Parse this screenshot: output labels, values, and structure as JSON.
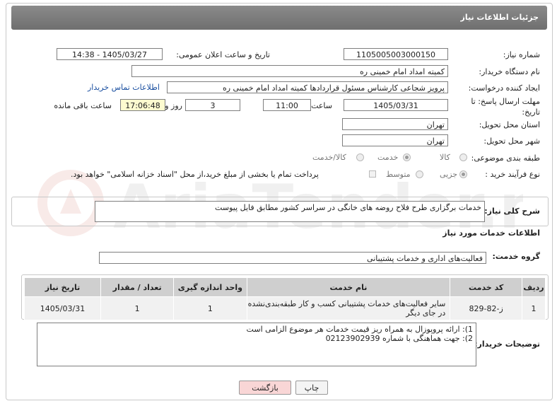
{
  "header": {
    "title": "جزئیات اطلاعات نیاز"
  },
  "form": {
    "need_number_label": "شماره نیاز:",
    "need_number": "1105005003000150",
    "announce_label": "تاریخ و ساعت اعلان عمومی:",
    "announce_value": "1405/03/27 - 14:38",
    "buyer_org_label": "نام دستگاه خریدار:",
    "buyer_org": "کمیته امداد امام خمینی ره",
    "creator_label": "ایجاد کننده درخواست:",
    "creator": "پرویز شجاعی کارشناس مسئول قراردادها کمیته امداد امام خمینی ره",
    "contact_link": "اطلاعات تماس خریدار",
    "deadline_label": "مهلت ارسال پاسخ: تا تاریخ:",
    "deadline_date": "1405/03/31",
    "time_label": "ساعت",
    "deadline_time": "11:00",
    "days_value": "3",
    "days_label": "روز و",
    "remaining_time": "17:06:48",
    "remaining_label": "ساعت باقی مانده",
    "province_label": "استان محل تحویل:",
    "province": "تهران",
    "city_label": "شهر محل تحویل:",
    "city": "تهران",
    "category_label": "طبقه بندی موضوعی:",
    "category_options": [
      "کالا",
      "خدمت",
      "کالا/خدمت"
    ],
    "category_selected": "خدمت",
    "process_label": "نوع فرآیند خرید :",
    "process_options": [
      "جزیی",
      "متوسط"
    ],
    "process_selected": "جزیی",
    "payment_note": "پرداخت تمام یا بخشی از مبلغ خرید،از محل \"اسناد خزانه اسلامی\" خواهد بود."
  },
  "summary": {
    "label": "شرح کلی نیاز:",
    "text": "خدمات برگزاری طرح فلاح روضه های خانگی در سراسر کشور مطابق فایل پیوست"
  },
  "services": {
    "section_title": "اطلاعات خدمات مورد نیاز",
    "group_label": "گروه خدمت:",
    "group_value": "فعالیت‌های اداری و خدمات پشتیبانی",
    "columns": [
      "ردیف",
      "کد خدمت",
      "نام خدمت",
      "واحد اندازه گیری",
      "تعداد / مقدار",
      "تاریخ نیاز"
    ],
    "rows": [
      {
        "index": "1",
        "code": "ز-82-829",
        "name": "سایر فعالیت‌های خدمات پشتیبانی کسب و کار طبقه‌بندی‌نشده در جای دیگر",
        "unit": "1",
        "quantity": "1",
        "date": "1405/03/31"
      }
    ]
  },
  "buyer_notes": {
    "label": "توضیحات خریدار:",
    "line1": "1): ارائه پروپوزال به همراه ریز قیمت خدمات هر موضوع الزامی است",
    "line2": "2): جهت هماهنگی با شماره 02123902939"
  },
  "buttons": {
    "print": "چاپ",
    "back": "بازگشت"
  },
  "watermark": "AriaTender.net",
  "colors": {
    "title_bar": "#7a7a7a",
    "link": "#1a4fa0",
    "yellow_box": "#fdfbd0",
    "back_button": "#f9d6d6"
  }
}
